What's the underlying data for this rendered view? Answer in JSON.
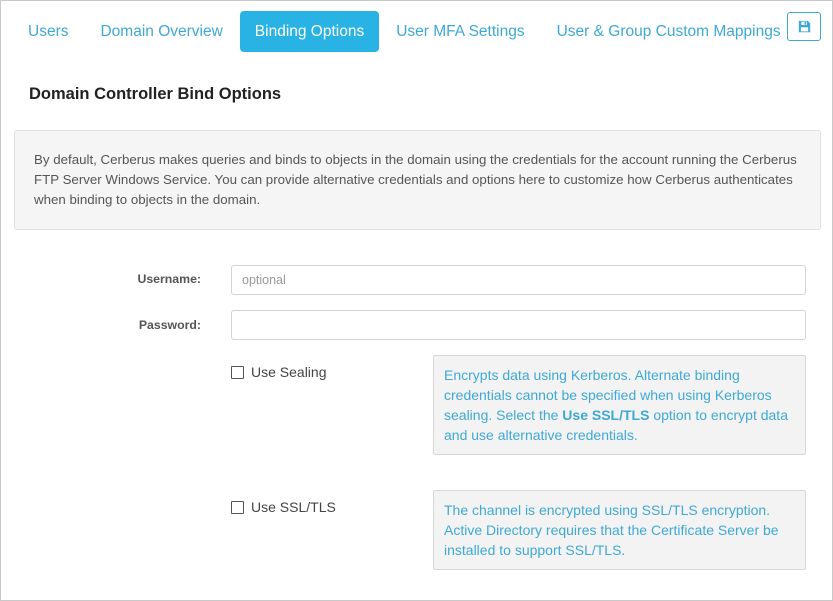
{
  "tabs": [
    {
      "label": "Users",
      "active": false
    },
    {
      "label": "Domain Overview",
      "active": false
    },
    {
      "label": "Binding Options",
      "active": true
    },
    {
      "label": "User MFA Settings",
      "active": false
    },
    {
      "label": "User & Group Custom Mappings",
      "active": false
    }
  ],
  "toolbar": {
    "save_icon": "save-icon"
  },
  "section_title": "Domain Controller Bind Options",
  "info_text": "By default, Cerberus makes queries and binds to objects in the domain using the credentials for the account running the Cerberus FTP Server Windows Service. You can provide alternative credentials and options here to customize how Cerberus authenticates when binding to objects in the domain.",
  "form": {
    "username_label": "Username:",
    "username_value": "",
    "username_placeholder": "optional",
    "password_label": "Password:",
    "password_value": ""
  },
  "sealing": {
    "label": "Use Sealing",
    "checked": false,
    "help_pre": "Encrypts data using Kerberos. Alternate binding credentials cannot be specified when using Kerberos sealing. Select the ",
    "help_bold": "Use SSL/TLS",
    "help_post": " option to encrypt data and use alternative credentials."
  },
  "ssl": {
    "label": "Use SSL/TLS",
    "checked": false,
    "help": "The channel is encrypted using SSL/TLS encryption. Active Directory requires that the Certificate Server be installed to support SSL/TLS."
  },
  "colors": {
    "accent": "#29b3e4",
    "link": "#3fa9d6"
  }
}
